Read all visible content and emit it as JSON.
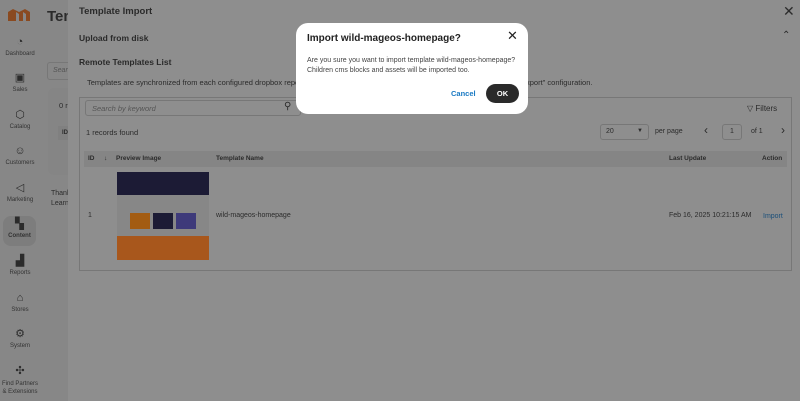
{
  "sidebar": {
    "items": [
      {
        "label": "Dashboard",
        "icon": "gauge-icon"
      },
      {
        "label": "Sales",
        "icon": "cash-icon"
      },
      {
        "label": "Catalog",
        "icon": "box-icon"
      },
      {
        "label": "Customers",
        "icon": "people-icon"
      },
      {
        "label": "Marketing",
        "icon": "megaphone-icon"
      },
      {
        "label": "Content",
        "icon": "layout-icon"
      },
      {
        "label": "Reports",
        "icon": "bar-chart-icon"
      },
      {
        "label": "Stores",
        "icon": "store-icon"
      },
      {
        "label": "System",
        "icon": "gear-icon"
      },
      {
        "label": "Find Partners & Extensions",
        "icon": "puzzle-icon"
      }
    ]
  },
  "background": {
    "title": "Tem",
    "search": "Sear",
    "records": "0 r",
    "col": "ID",
    "thanks": "Thank",
    "learn": "Learn"
  },
  "panel": {
    "title": "Template Import",
    "upload": "Upload from disk",
    "remote": "Remote Templates List",
    "description_left": "Templates are synchronized from each configured dropbox reposito",
    "description_right": "xport\" configuration.",
    "search_placeholder": "Search by keyword",
    "filters": "Filters",
    "records": "1 records found",
    "per_page_value": "20",
    "per_page": "per page",
    "page": "1",
    "of": "of 1",
    "columns": {
      "id": "ID",
      "preview": "Preview Image",
      "name": "Template Name",
      "updated": "Last Update",
      "action": "Action"
    },
    "rows": [
      {
        "id": "1",
        "name": "wild-mageos-homepage",
        "updated": "Feb 16, 2025 10:21:15 AM",
        "action": "Import"
      }
    ]
  },
  "modal": {
    "title": "Import wild-mageos-homepage?",
    "line1": "Are you sure you want to import template wild-mageos-homepage?",
    "line2": "Children cms blocks and assets will be imported too.",
    "cancel": "Cancel",
    "ok": "OK"
  },
  "colors": {
    "accent": "#1979c3",
    "logo": "#c2561a"
  }
}
